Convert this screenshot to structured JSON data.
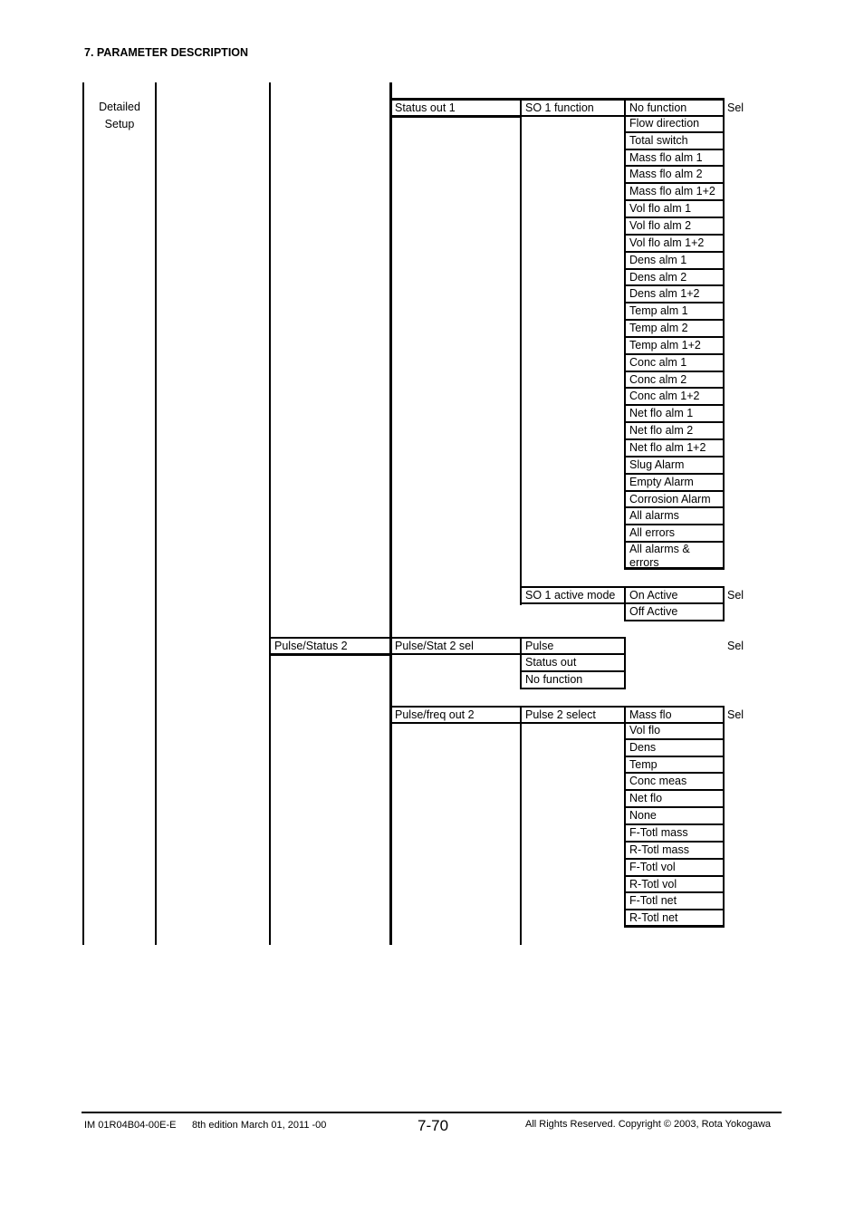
{
  "page": {
    "section_title": "7. PARAMETER DESCRIPTION",
    "footer": {
      "doc_id": "IM 01R04B04-00E-E",
      "edition": "8th edition March 01, 2011 -00",
      "page_number": "7-70",
      "copyright": "All Rights Reserved. Copyright © 2003, Rota Yokogawa"
    }
  },
  "tree": {
    "level1": {
      "label_line1": "Detailed",
      "label_line2": "Setup"
    },
    "status_out_1": {
      "label": "Status out 1",
      "so1_function": {
        "label": "SO 1 function",
        "type": "Sel",
        "options": [
          "No function",
          "Flow direction",
          "Total switch",
          "Mass flo alm 1",
          "Mass flo alm 2",
          "Mass flo alm 1+2",
          "Vol flo alm 1",
          "Vol flo alm 2",
          "Vol flo alm 1+2",
          "Dens alm 1",
          "Dens alm 2",
          "Dens alm 1+2",
          "Temp alm 1",
          "Temp alm 2",
          "Temp alm 1+2",
          "Conc alm 1",
          "Conc alm 2",
          "Conc alm 1+2",
          "Net flo alm 1",
          "Net flo alm 2",
          "Net flo alm 1+2",
          "Slug Alarm",
          "Empty Alarm",
          "Corrosion Alarm",
          "All alarms",
          "All errors"
        ],
        "last_option_line1": "All alarms &",
        "last_option_line2": "errors"
      },
      "so1_active_mode": {
        "label": "SO 1 active mode",
        "type": "Sel",
        "options": [
          "On Active",
          "Off Active"
        ]
      }
    },
    "pulse_status_2": {
      "label": "Pulse/Status 2",
      "pulse_stat_2_sel": {
        "label": "Pulse/Stat 2 sel",
        "type": "Sel",
        "options": [
          "Pulse",
          "Status out",
          "No function"
        ]
      },
      "pulse_freq_out_2": {
        "label": "Pulse/freq out 2",
        "pulse_2_select": {
          "label": "Pulse 2 select",
          "type": "Sel",
          "options": [
            "Mass flo",
            "Vol flo",
            "Dens",
            "Temp",
            "Conc meas",
            "Net flo",
            "None",
            "F-Totl mass",
            "R-Totl mass",
            "F-Totl vol",
            "R-Totl vol",
            "F-Totl net",
            "R-Totl net"
          ]
        }
      }
    }
  }
}
